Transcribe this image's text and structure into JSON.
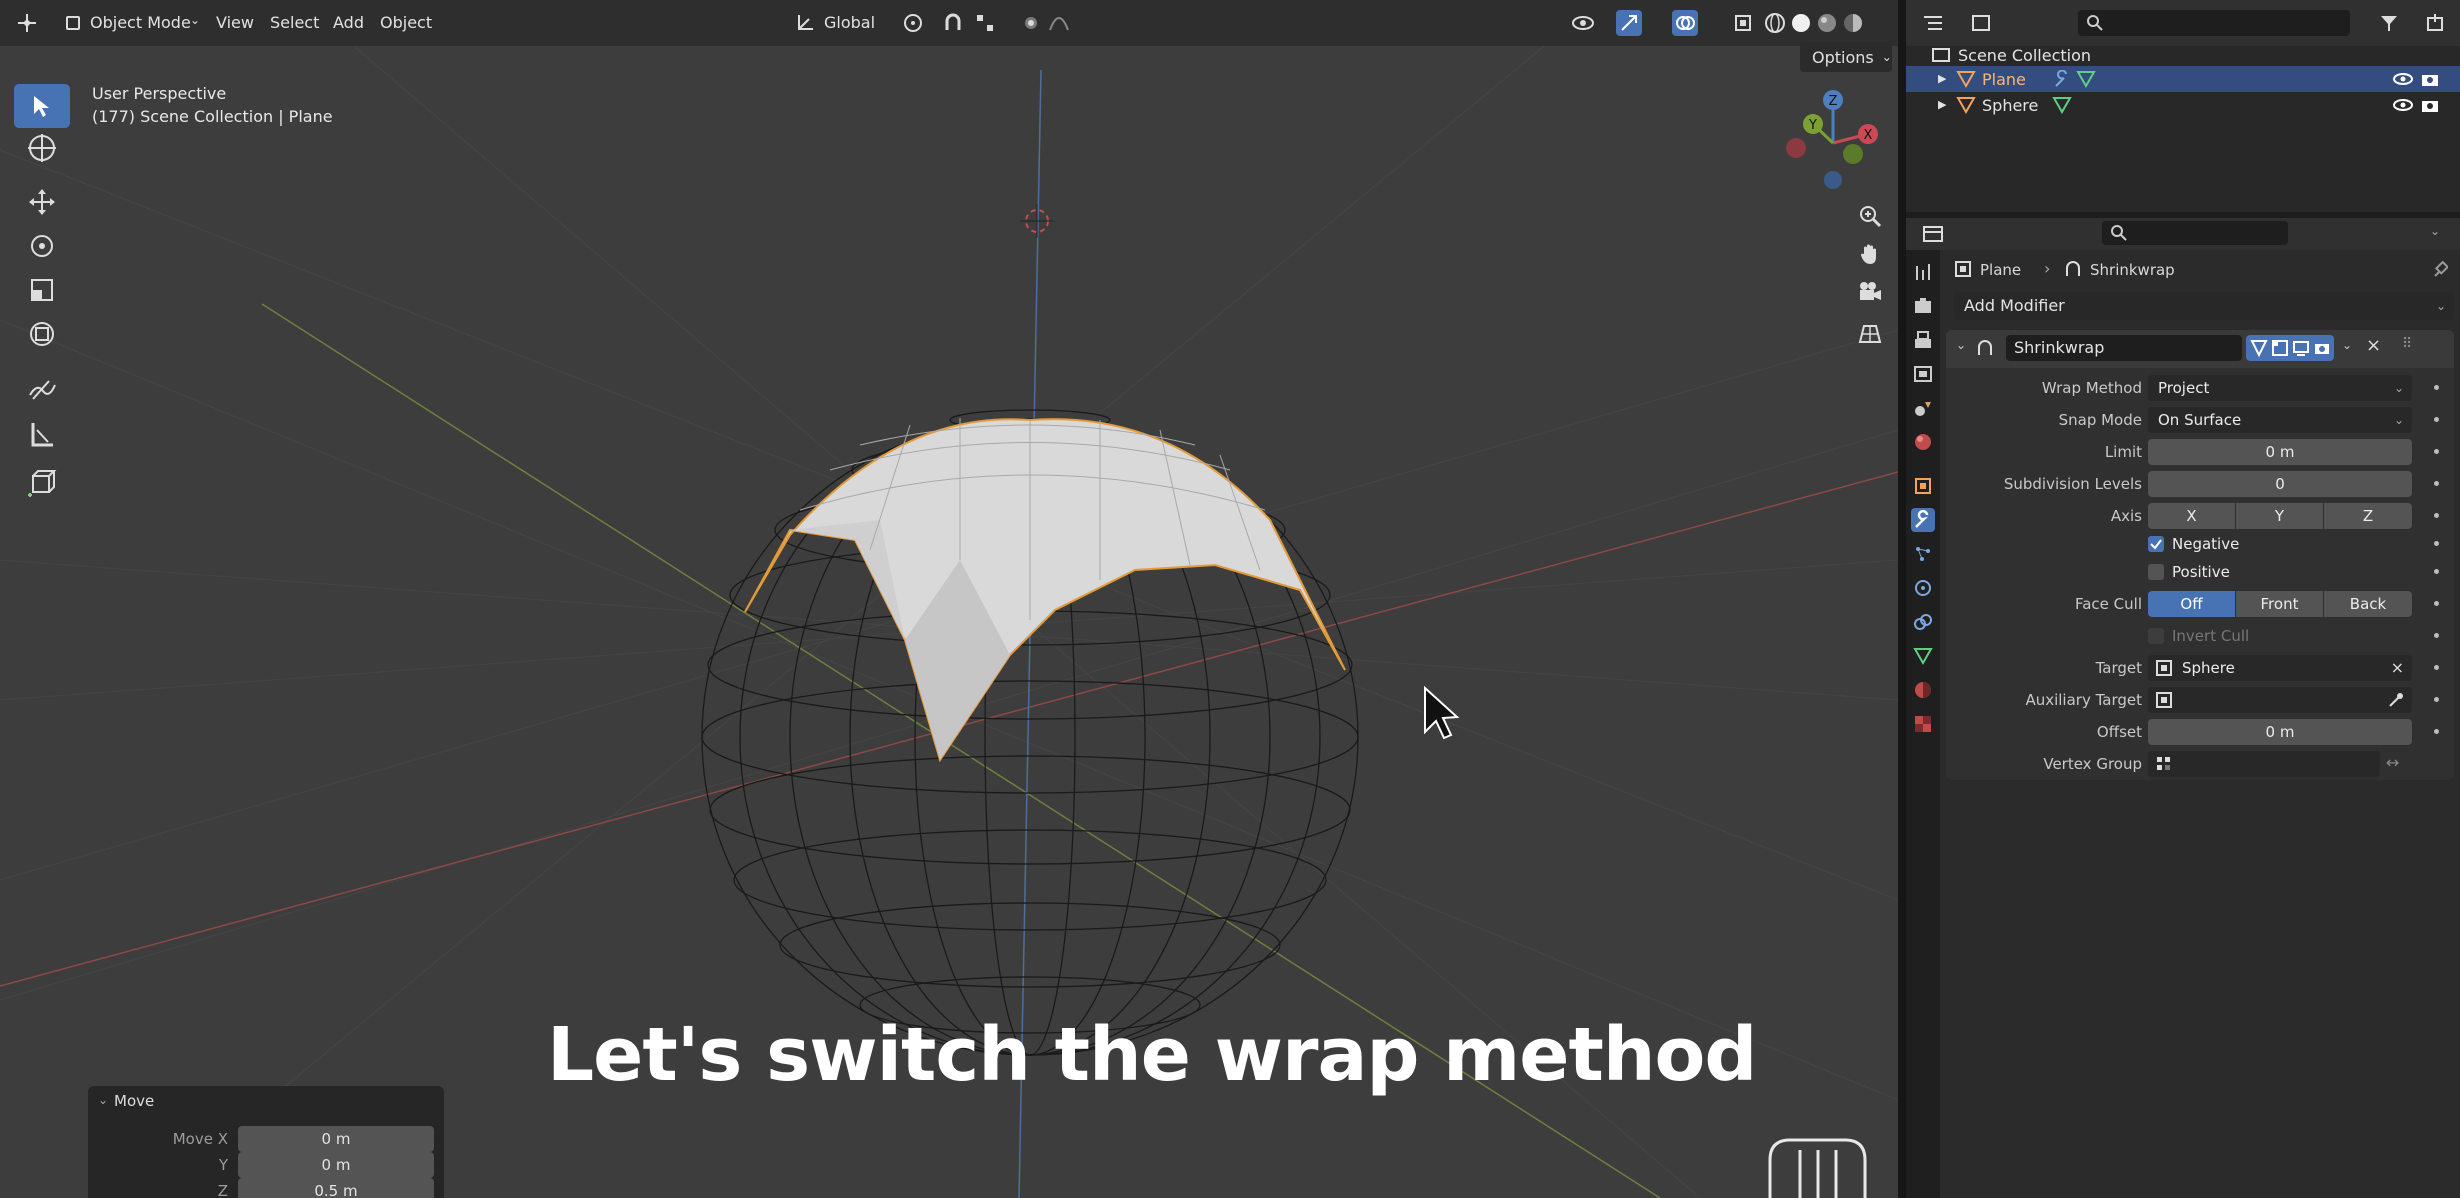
{
  "viewport": {
    "header": {
      "editor_icon": "3d-viewport-icon",
      "mode": "Object Mode",
      "menus": [
        "View",
        "Select",
        "Add",
        "Object"
      ],
      "transform_orientation": "Global"
    },
    "overlay_text": {
      "view_name": "User Perspective",
      "collection_path": "(177) Scene Collection | Plane"
    },
    "options_label": "Options",
    "gizmo_axes": {
      "x": "X",
      "y": "Y",
      "z": "Z"
    },
    "move_panel": {
      "title": "Move",
      "rows": [
        {
          "label": "Move X",
          "value": "0 m"
        },
        {
          "label": "Y",
          "value": "0 m"
        },
        {
          "label": "Z",
          "value": "0.5 m"
        }
      ]
    },
    "subtitle": "Let's switch the wrap method",
    "colors": {
      "x_axis": "#a04646",
      "y_axis": "#7d9a3d",
      "z_axis": "#4e7fc0",
      "selection": "#e39a3a"
    }
  },
  "outliner": {
    "root": "Scene Collection",
    "items": [
      {
        "name": "Plane",
        "selected": true
      },
      {
        "name": "Sphere",
        "selected": false
      }
    ]
  },
  "properties": {
    "breadcrumb": {
      "object": "Plane",
      "modifier": "Shrinkwrap"
    },
    "add_modifier": "Add Modifier",
    "modifier": {
      "name": "Shrinkwrap",
      "wrap_method_label": "Wrap Method",
      "wrap_method": "Project",
      "snap_mode_label": "Snap Mode",
      "snap_mode": "On Surface",
      "limit_label": "Limit",
      "limit": "0 m",
      "subdivision_label": "Subdivision Levels",
      "subdivision": "0",
      "axis_label": "Axis",
      "axis_options": [
        "X",
        "Y",
        "Z"
      ],
      "negative_label": "Negative",
      "negative": true,
      "positive_label": "Positive",
      "positive": false,
      "face_cull_label": "Face Cull",
      "face_cull_options": [
        "Off",
        "Front",
        "Back"
      ],
      "face_cull_selected": "Off",
      "invert_cull_label": "Invert Cull",
      "target_label": "Target",
      "target": "Sphere",
      "aux_target_label": "Auxiliary Target",
      "aux_target": "",
      "offset_label": "Offset",
      "offset": "0 m",
      "vertex_group_label": "Vertex Group",
      "vertex_group": ""
    }
  }
}
